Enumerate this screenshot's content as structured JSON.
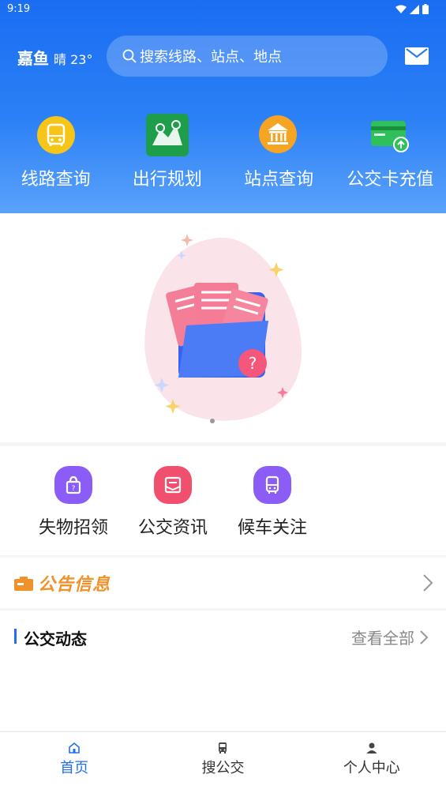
{
  "status_bar": {
    "time": "9:19"
  },
  "header": {
    "city": "嘉鱼",
    "weather": "晴 23°",
    "search_placeholder": "搜索线路、站点、地点"
  },
  "quick_nav": [
    {
      "label": "线路查询",
      "icon": "bus-route-icon"
    },
    {
      "label": "出行规划",
      "icon": "map-icon"
    },
    {
      "label": "站点查询",
      "icon": "station-icon"
    },
    {
      "label": "公交卡充值",
      "icon": "card-recharge-icon"
    }
  ],
  "features": [
    {
      "label": "失物招领",
      "icon": "lost-found-icon",
      "color": "#8b5cf6"
    },
    {
      "label": "公交资讯",
      "icon": "news-icon",
      "color": "#f0506e"
    },
    {
      "label": "候车关注",
      "icon": "bus-watch-icon",
      "color": "#8b5cf6"
    }
  ],
  "notice": {
    "title": "公告信息"
  },
  "dynamics": {
    "title": "公交动态",
    "more_label": "查看全部"
  },
  "bottom_nav": [
    {
      "label": "首页",
      "icon": "home-icon",
      "active": true
    },
    {
      "label": "搜公交",
      "icon": "bus-icon",
      "active": false
    },
    {
      "label": "个人中心",
      "icon": "user-icon",
      "active": false
    }
  ],
  "colors": {
    "primary": "#1f6ff3",
    "header_top": "#1a6df2",
    "notice": "#f0912a"
  }
}
